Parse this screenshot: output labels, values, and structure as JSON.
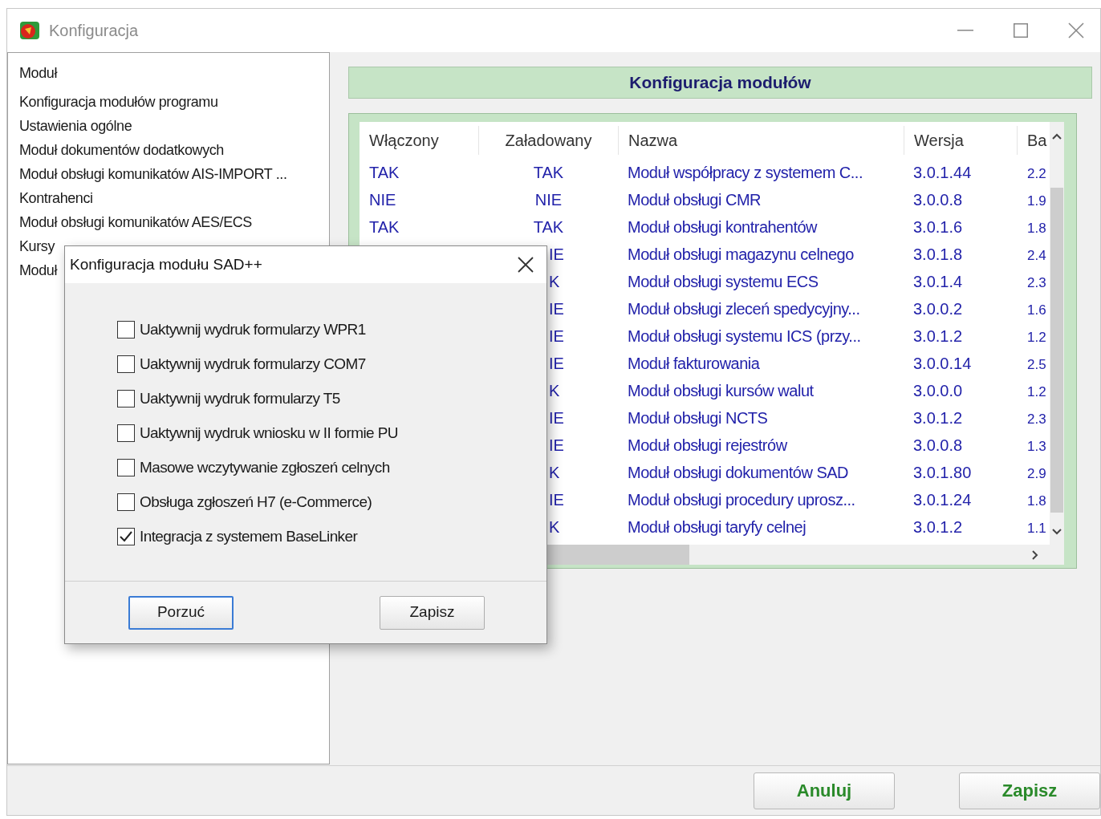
{
  "window": {
    "title": "Konfiguracja"
  },
  "sidebar": {
    "items": [
      "Moduł",
      "Konfiguracja modułów programu",
      "Ustawienia ogólne",
      "Moduł dokumentów dodatkowych",
      "Moduł obsługi komunikatów AIS-IMPORT ...",
      "Kontrahenci",
      "Moduł obsługi komunikatów AES/ECS",
      "Kursy",
      "Moduł"
    ]
  },
  "panel_title": "Konfiguracja modułów",
  "table": {
    "columns": [
      "Włączony",
      "Załadowany",
      "Nazwa",
      "Wersja",
      "Ba"
    ],
    "rows": [
      {
        "enabled": "TAK",
        "loaded": "TAK",
        "name": "Moduł współpracy z systemem C...",
        "version": "3.0.1.44",
        "column_5": "2.2"
      },
      {
        "enabled": "NIE",
        "loaded": "NIE",
        "name": "Moduł obsługi CMR",
        "version": "3.0.0.8",
        "column_5": "1.9"
      },
      {
        "enabled": "TAK",
        "loaded": "TAK",
        "name": "Moduł obsługi kontrahentów",
        "version": "3.0.1.6",
        "column_5": "1.8"
      },
      {
        "loaded": "IE",
        "name": "Moduł obsługi magazynu celnego",
        "version": "3.0.1.8",
        "column_5": "2.4"
      },
      {
        "loaded": "K",
        "name": "Moduł obsługi systemu ECS",
        "version": "3.0.1.4",
        "column_5": "2.3"
      },
      {
        "loaded": "IE",
        "name": "Moduł obsługi zleceń spedycyjny...",
        "version": "3.0.0.2",
        "column_5": "1.6"
      },
      {
        "loaded": "IE",
        "name": "Moduł obsługi systemu ICS (przy...",
        "version": "3.0.1.2",
        "column_5": "1.2"
      },
      {
        "loaded": "IE",
        "name": "Moduł fakturowania",
        "version": "3.0.0.14",
        "column_5": "2.5"
      },
      {
        "loaded": "K",
        "name": "Moduł obsługi kursów walut",
        "version": "3.0.0.0",
        "column_5": "1.2"
      },
      {
        "loaded": "IE",
        "name": "Moduł obsługi NCTS",
        "version": "3.0.1.2",
        "column_5": "2.3"
      },
      {
        "loaded": "IE",
        "name": "Moduł obsługi rejestrów",
        "version": "3.0.0.8",
        "column_5": "1.3"
      },
      {
        "loaded": "K",
        "name": "Moduł obsługi dokumentów SAD",
        "version": "3.0.1.80",
        "column_5": "2.9"
      },
      {
        "loaded": "IE",
        "name": "Moduł obsługi procedury uprosz...",
        "version": "3.0.1.24",
        "column_5": "1.8"
      },
      {
        "loaded": "K",
        "name": "Moduł obsługi taryfy celnej",
        "version": "3.0.1.2",
        "column_5": "1.1"
      }
    ]
  },
  "buttons": [
    "Anuluj",
    "Zapisz"
  ],
  "dialog": {
    "title": "Konfiguracja modułu SAD++",
    "options": [
      {
        "label": "Uaktywnij wydruk formularzy WPR1",
        "checked": false
      },
      {
        "label": "Uaktywnij wydruk formularzy COM7",
        "checked": false
      },
      {
        "label": "Uaktywnij wydruk formularzy T5",
        "checked": false
      },
      {
        "label": "Uaktywnij wydruk wniosku w II formie PU",
        "checked": false
      },
      {
        "label": "Masowe wczytywanie zgłoszeń celnych",
        "checked": false
      },
      {
        "label": "Obsługa zgłoszeń H7 (e-Commerce)",
        "checked": false
      },
      {
        "label": "Integracja z systemem BaseLinker",
        "checked": true
      }
    ],
    "buttons": [
      {
        "label": "Porzuć",
        "focused": true
      },
      {
        "label": "Zapisz",
        "focused": false
      }
    ]
  }
}
